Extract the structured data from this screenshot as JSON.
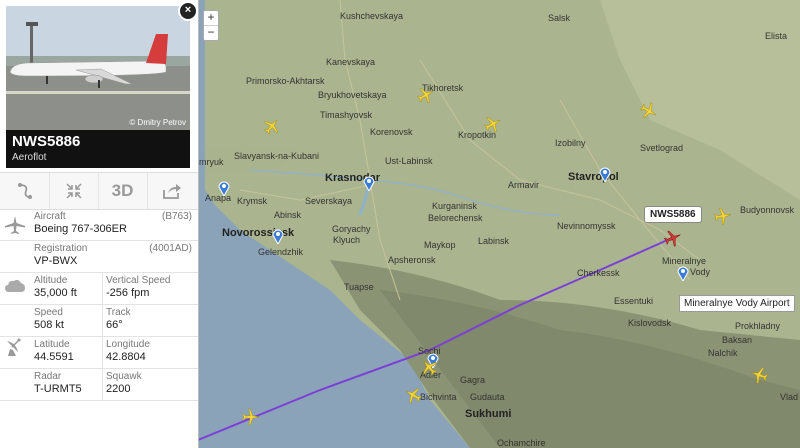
{
  "map": {
    "zoom_in": "+",
    "zoom_out": "−",
    "cities": [
      {
        "name": "Kushchevskaya",
        "big": false
      },
      {
        "name": "Salsk",
        "big": false
      },
      {
        "name": "Elista",
        "big": false
      },
      {
        "name": "Kanevskaya",
        "big": false
      },
      {
        "name": "Primorsko-Akhtarsk",
        "big": false
      },
      {
        "name": "Tikhoretsk",
        "big": false
      },
      {
        "name": "Bryukhovetskaya",
        "big": false
      },
      {
        "name": "Timashyovsk",
        "big": false
      },
      {
        "name": "Korenovsk",
        "big": false
      },
      {
        "name": "Kropotkin",
        "big": false
      },
      {
        "name": "Izobilny",
        "big": false
      },
      {
        "name": "Svetlograd",
        "big": false
      },
      {
        "name": "Slavyansk-na-Kubani",
        "big": false
      },
      {
        "name": "Ust-Labinsk",
        "big": false
      },
      {
        "name": "mryuk",
        "big": false
      },
      {
        "name": "Krasnodar",
        "big": true
      },
      {
        "name": "Armavir",
        "big": false
      },
      {
        "name": "Stavropol",
        "big": true
      },
      {
        "name": "Anapa",
        "big": false
      },
      {
        "name": "Krymsk",
        "big": false
      },
      {
        "name": "Severskaya",
        "big": false
      },
      {
        "name": "Abinsk",
        "big": false
      },
      {
        "name": "Kurganinsk",
        "big": false
      },
      {
        "name": "Belorechensk",
        "big": false
      },
      {
        "name": "Nevinnomyssk",
        "big": false
      },
      {
        "name": "Budyonnovsk",
        "big": false
      },
      {
        "name": "Novorossiysk",
        "big": true
      },
      {
        "name": "Goryachy",
        "big": false
      },
      {
        "name": "Klyuch",
        "big": false
      },
      {
        "name": "Labinsk",
        "big": false
      },
      {
        "name": "Gelendzhik",
        "big": false
      },
      {
        "name": "Maykop",
        "big": false
      },
      {
        "name": "Apsheronsk",
        "big": false
      },
      {
        "name": "Cherkessk",
        "big": false
      },
      {
        "name": "Mineralnye",
        "big": false
      },
      {
        "name": "Vody",
        "big": false
      },
      {
        "name": "Tuapse",
        "big": false
      },
      {
        "name": "Essentuki",
        "big": false
      },
      {
        "name": "Kislovodsk",
        "big": false
      },
      {
        "name": "Prokhladny",
        "big": false
      },
      {
        "name": "Baksan",
        "big": false
      },
      {
        "name": "Nalchik",
        "big": false
      },
      {
        "name": "Sochi",
        "big": false
      },
      {
        "name": "Adler",
        "big": false
      },
      {
        "name": "Gagra",
        "big": false
      },
      {
        "name": "Bichvinta",
        "big": false
      },
      {
        "name": "Gudauta",
        "big": false
      },
      {
        "name": "Sukhumi",
        "big": true
      },
      {
        "name": "Ochamchire",
        "big": false
      },
      {
        "name": "Vlad",
        "big": false
      }
    ],
    "flight_label": "NWS5886",
    "airport_tooltip": "Mineralnye Vody Airport",
    "track_color": "#7b3fd6",
    "plane_color": "#f2d33b",
    "selected_plane_color": "#d23a3a"
  },
  "panel": {
    "photo_credit": "© Dmitry Petrov",
    "close_label": "×",
    "callsign": "NWS5886",
    "airline": "Aeroflot",
    "toolbar": {
      "route_icon": "route-icon",
      "fit_icon": "fit-view-icon",
      "three_d_label": "3D",
      "share_icon": "share-icon"
    },
    "aircraft": {
      "label": "Aircraft",
      "code": "(B763)",
      "value": "Boeing 767-306ER"
    },
    "registration": {
      "label": "Registration",
      "code": "(4001AD)",
      "value": "VP-BWX"
    },
    "altitude": {
      "label": "Altitude",
      "value": "35,000 ft"
    },
    "vertical_speed": {
      "label": "Vertical Speed",
      "value": "-256 fpm"
    },
    "speed": {
      "label": "Speed",
      "value": "508 kt"
    },
    "track": {
      "label": "Track",
      "value": "66°"
    },
    "latitude": {
      "label": "Latitude",
      "value": "44.5591"
    },
    "longitude": {
      "label": "Longitude",
      "value": "42.8804"
    },
    "radar": {
      "label": "Radar",
      "value": "T-URMT5"
    },
    "squawk": {
      "label": "Squawk",
      "value": "2200"
    }
  }
}
